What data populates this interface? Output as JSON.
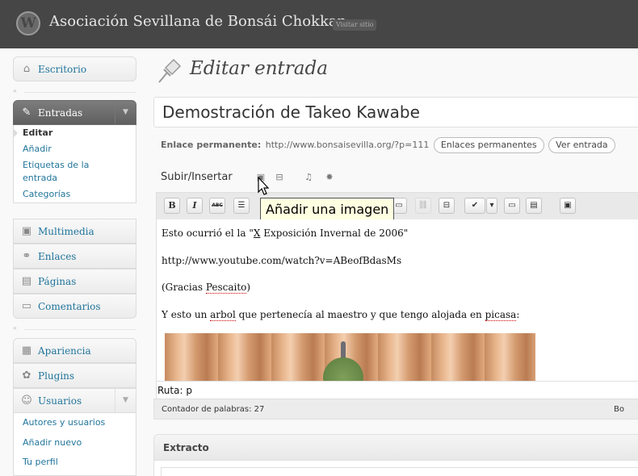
{
  "header": {
    "logo_letter": "W",
    "site_title": "Asociación Sevillana de Bonsái Chokkan",
    "visit_site": "Visitar sitio"
  },
  "sidebar": {
    "escritorio": "Escritorio",
    "entradas": "Entradas",
    "entradas_sub": [
      "Editar",
      "Añadir",
      "Etiquetas de la entrada",
      "Categorías"
    ],
    "multimedia": "Multimedia",
    "enlaces": "Enlaces",
    "paginas": "Páginas",
    "comentarios": "Comentarios",
    "apariencia": "Apariencia",
    "plugins": "Plugins",
    "usuarios": "Usuarios",
    "usuarios_sub": [
      "Autores y usuarios",
      "Añadir nuevo",
      "Tu perfil"
    ]
  },
  "main": {
    "page_title": "Editar entrada",
    "post_title": "Demostración de Takeo Kawabe",
    "permalink_label": "Enlace permanente:",
    "permalink_url": "http://www.bonsaisevilla.org/?p=111",
    "btn_permalinks": "Enlaces permanentes",
    "btn_view": "Ver entrada",
    "media_label": "Subir/Insertar",
    "tooltip": "Añadir una imagen",
    "content": {
      "p1_before": "Esto ocurrió el la  \"",
      "p1_link_x": "X",
      "p1_after": " Exposición Invernal de 2006\"",
      "p2": "http://www.youtube.com/watch?v=ABeofBdasMs",
      "p3_before": "(Gracias ",
      "p3_link": "Pescaito",
      "p3_after": ")",
      "p4_a": "Y esto un ",
      "p4_arbol": "arbol",
      "p4_b": " que pertenecía al maestro y que tengo alojada en ",
      "p4_picasa": "picasa",
      "p4_c": ":"
    },
    "path": "Ruta: p",
    "word_count": "Contador de palabras: 27",
    "word_right": "Bo",
    "excerpt_title": "Extracto"
  },
  "colors": {
    "header_bg": "#464646",
    "link": "#21759b",
    "current_menu": "#6d6d6d",
    "tooltip_bg": "#ffffe1"
  }
}
